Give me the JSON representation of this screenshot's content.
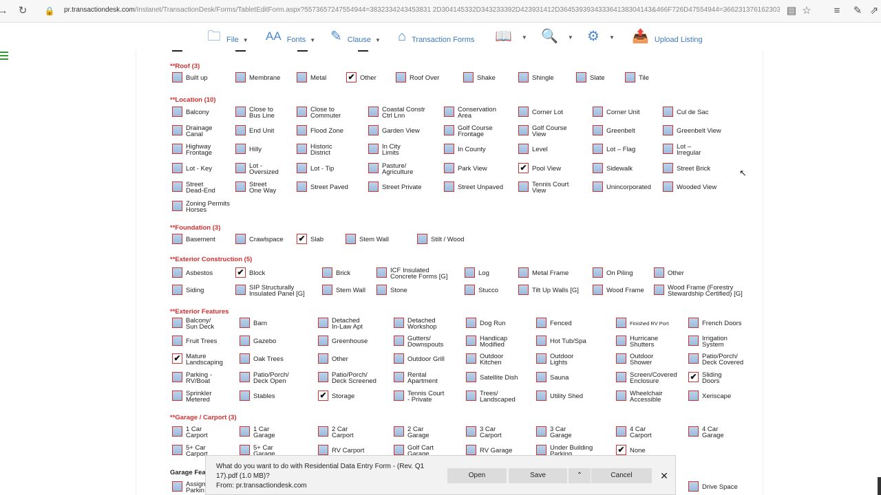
{
  "browser": {
    "url_domain": "pr.transactiondesk.com",
    "url_rest": "/Instanet/TransactionDesk/Forms/TabletEditForm.aspx?5573657247554944=3832334243453831 2D304145332D343233392D423931412D364539393433364138304143&466F726D47554944=3662313761623038 2D666665332D34336"
  },
  "toolbar": {
    "file": "File",
    "fonts": "Fonts",
    "clause": "Clause",
    "transaction_forms": "Transaction Forms",
    "upload_listing": "Upload Listing"
  },
  "sections": {
    "roof": "**Roof (3)",
    "location": "**Location (10)",
    "foundation": "**Foundation (3)",
    "exterior_construction": "**Exterior Construction (5)",
    "exterior_features": "**Exterior Features",
    "garage_carport": "**Garage / Carport (3)",
    "garage_features": "Garage Fea"
  },
  "options": {
    "roof": [
      {
        "label": "Built up",
        "checked": false
      },
      {
        "label": "Membrane",
        "checked": false
      },
      {
        "label": "Metal",
        "checked": false
      },
      {
        "label": "Other",
        "checked": true
      },
      {
        "label": "Roof Over",
        "checked": false
      },
      {
        "label": "Shake",
        "checked": false
      },
      {
        "label": "Shingle",
        "checked": false
      },
      {
        "label": "Slate",
        "checked": false
      },
      {
        "label": "Tile",
        "checked": false
      }
    ],
    "location": [
      {
        "label": "Balcony",
        "checked": false
      },
      {
        "label": "Close to\nBus Line",
        "checked": false
      },
      {
        "label": "Close to\nCommuter",
        "checked": false
      },
      {
        "label": "Coastal Constr\nCtrl Lnn",
        "checked": false
      },
      {
        "label": "Conservation\nArea",
        "checked": false
      },
      {
        "label": "Corner Lot",
        "checked": false
      },
      {
        "label": "Corner Unit",
        "checked": false
      },
      {
        "label": "Cul de Sac",
        "checked": false
      },
      {
        "label": "Drainage\nCanal",
        "checked": false
      },
      {
        "label": "End Unit",
        "checked": false
      },
      {
        "label": "Flood Zone",
        "checked": false
      },
      {
        "label": "Garden View",
        "checked": false
      },
      {
        "label": "Golf Course\nFrontage",
        "checked": false
      },
      {
        "label": "Golf Course\nView",
        "checked": false
      },
      {
        "label": "Greenbelt",
        "checked": false
      },
      {
        "label": "Greenbelt View",
        "checked": false
      },
      {
        "label": "Highway\nFrontage",
        "checked": false
      },
      {
        "label": "Hilly",
        "checked": false
      },
      {
        "label": "Historic\nDistrict",
        "checked": false
      },
      {
        "label": "In City\nLimits",
        "checked": false
      },
      {
        "label": "In County",
        "checked": false
      },
      {
        "label": "Level",
        "checked": false
      },
      {
        "label": "Lot – Flag",
        "checked": false
      },
      {
        "label": "Lot –\nIrregular",
        "checked": false
      },
      {
        "label": "Lot - Key",
        "checked": false
      },
      {
        "label": "Lot -\nOversized",
        "checked": false
      },
      {
        "label": "Lot - Tip",
        "checked": false
      },
      {
        "label": "Pasture/\nAgriculture",
        "checked": false
      },
      {
        "label": "Park View",
        "checked": false
      },
      {
        "label": "Pool View",
        "checked": true
      },
      {
        "label": "Sidewalk",
        "checked": false
      },
      {
        "label": "Street Brick",
        "checked": false
      },
      {
        "label": "Street\nDead-End",
        "checked": false
      },
      {
        "label": "Street\nOne Way",
        "checked": false
      },
      {
        "label": "Street Paved",
        "checked": false
      },
      {
        "label": "Street Private",
        "checked": false
      },
      {
        "label": "Street Unpaved",
        "checked": false
      },
      {
        "label": "Tennis Court\nView",
        "checked": false
      },
      {
        "label": "Unincorporated",
        "checked": false
      },
      {
        "label": "Wooded View",
        "checked": false
      },
      {
        "label": "Zoning Permits\nHorses",
        "checked": false
      }
    ],
    "foundation": [
      {
        "label": "Basement",
        "checked": false
      },
      {
        "label": "Crawlspace",
        "checked": false
      },
      {
        "label": "Slab",
        "checked": true
      },
      {
        "label": "Stem Wall",
        "checked": false
      },
      {
        "label": "Stilt / Wood",
        "checked": false
      }
    ],
    "exterior_construction": [
      {
        "label": "Asbestos",
        "checked": false
      },
      {
        "label": "Block",
        "checked": true
      },
      {
        "label": "Brick",
        "checked": false
      },
      {
        "label": "ICF Insulated\nConcrete Forms [G]",
        "checked": false
      },
      {
        "label": "Log",
        "checked": false
      },
      {
        "label": "Metal Frame",
        "checked": false
      },
      {
        "label": "On Piling",
        "checked": false
      },
      {
        "label": "Other",
        "checked": false
      },
      {
        "label": "Siding",
        "checked": false
      },
      {
        "label": "SIP Structurally\nInsulated Panel [G]",
        "checked": false
      },
      {
        "label": "Stem Wall",
        "checked": false
      },
      {
        "label": "Stone",
        "checked": false
      },
      {
        "label": "Stucco",
        "checked": false
      },
      {
        "label": "Tilt Up Walls [G]",
        "checked": false
      },
      {
        "label": "Wood Frame",
        "checked": false
      },
      {
        "label": "Wood Frame (Forestry\nStewardship Certified) [G]",
        "checked": false
      }
    ],
    "exterior_features": [
      {
        "label": "Balcony/\nSun Deck",
        "checked": false
      },
      {
        "label": "Barn",
        "checked": false
      },
      {
        "label": "Detached\nIn-Law Apt",
        "checked": false
      },
      {
        "label": "Detached\nWorkshop",
        "checked": false
      },
      {
        "label": "Dog Run",
        "checked": false
      },
      {
        "label": "Fenced",
        "checked": false
      },
      {
        "label": "Finished RV Port",
        "checked": false,
        "small": true
      },
      {
        "label": "French Doors",
        "checked": false
      },
      {
        "label": "Fruit Trees",
        "checked": false
      },
      {
        "label": "Gazebo",
        "checked": false
      },
      {
        "label": "Greenhouse",
        "checked": false
      },
      {
        "label": "Gutters/\nDownspouts",
        "checked": false
      },
      {
        "label": "Handicap\nModified",
        "checked": false
      },
      {
        "label": "Hot Tub/Spa",
        "checked": false
      },
      {
        "label": "Hurricane\nShutters",
        "checked": false
      },
      {
        "label": "Irrigation\nSystem",
        "checked": false
      },
      {
        "label": "Mature\nLandscaping",
        "checked": true
      },
      {
        "label": "Oak Trees",
        "checked": false
      },
      {
        "label": "Other",
        "checked": false
      },
      {
        "label": "Outdoor Grill",
        "checked": false
      },
      {
        "label": "Outdoor\nKitchen",
        "checked": false
      },
      {
        "label": "Outdoor\nLights",
        "checked": false
      },
      {
        "label": "Outdoor\nShower",
        "checked": false
      },
      {
        "label": "Patio/Porch/\nDeck Covered",
        "checked": false
      },
      {
        "label": "Parking -\nRV/Boat",
        "checked": false
      },
      {
        "label": "Patio/Porch/\nDeck Open",
        "checked": false
      },
      {
        "label": "Patio/Porch/\nDeck Screened",
        "checked": false
      },
      {
        "label": "Rental\nApartment",
        "checked": false
      },
      {
        "label": "Satellite Dish",
        "checked": false
      },
      {
        "label": "Sauna",
        "checked": false
      },
      {
        "label": "Screen/Covered\nEnclosure",
        "checked": false
      },
      {
        "label": "Sliding\nDoors",
        "checked": true
      },
      {
        "label": "Sprinkler\nMetered",
        "checked": false
      },
      {
        "label": "Stables",
        "checked": false
      },
      {
        "label": "Storage",
        "checked": true
      },
      {
        "label": "Tennis Court\n- Private",
        "checked": false
      },
      {
        "label": "Trees/\nLandscaped",
        "checked": false
      },
      {
        "label": "Utility Shed",
        "checked": false
      },
      {
        "label": "Wheelchair\nAccessible",
        "checked": false
      },
      {
        "label": "Xeriscape",
        "checked": false
      }
    ],
    "garage_carport": [
      {
        "label": "1 Car\nCarport",
        "checked": false
      },
      {
        "label": "1 Car\nGarage",
        "checked": false
      },
      {
        "label": "2 Car\nCarport",
        "checked": false
      },
      {
        "label": "2 Car\nGarage",
        "checked": false
      },
      {
        "label": "3 Car\nCarport",
        "checked": false
      },
      {
        "label": "3 Car\nGarage",
        "checked": false
      },
      {
        "label": "4 Car\nCarport",
        "checked": false
      },
      {
        "label": "4 Car\nGarage",
        "checked": false
      },
      {
        "label": "5+ Car\nCarport",
        "checked": false
      },
      {
        "label": "5+ Car\nGarage",
        "checked": false
      },
      {
        "label": "RV Carport",
        "checked": false
      },
      {
        "label": "Golf Cart\nGarage",
        "checked": false
      },
      {
        "label": "RV Garage",
        "checked": false
      },
      {
        "label": "Under Building\nParking",
        "checked": false
      },
      {
        "label": "None",
        "checked": true
      }
    ],
    "garage_features": [
      {
        "label": "Assign\nParkin",
        "checked": false
      },
      {
        "label": "Drive Space",
        "checked": false
      }
    ]
  },
  "download_bar": {
    "message": "What do you want to do with Residential Data Entry Form - (Rev. Q1 17).pdf (1.0 MB)?",
    "from": "From: pr.transactiondesk.com",
    "open": "Open",
    "save": "Save",
    "cancel": "Cancel"
  },
  "colors": {
    "accent": "#3a7abf",
    "section": "#d03030",
    "checkbox_border": "#cc3333"
  }
}
